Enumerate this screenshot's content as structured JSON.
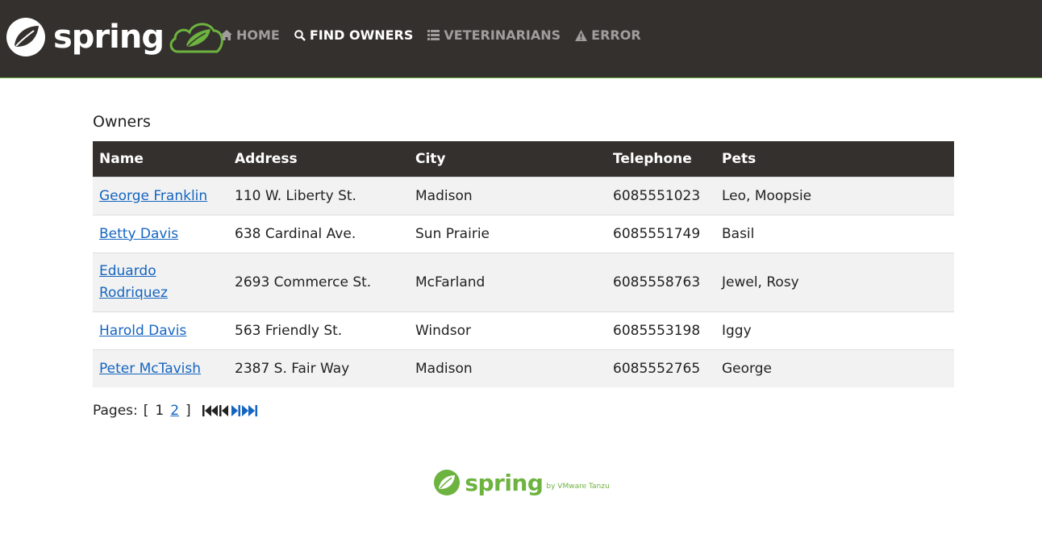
{
  "nav": {
    "brand": "spring",
    "items": [
      {
        "label": "HOME",
        "icon": "home-icon"
      },
      {
        "label": "FIND OWNERS",
        "icon": "search-icon",
        "active": true
      },
      {
        "label": "VETERINARIANS",
        "icon": "list-icon"
      },
      {
        "label": "ERROR",
        "icon": "warning-icon"
      }
    ]
  },
  "page": {
    "title": "Owners"
  },
  "table": {
    "headers": [
      "Name",
      "Address",
      "City",
      "Telephone",
      "Pets"
    ],
    "rows": [
      {
        "name": "George Franklin",
        "address": "110 W. Liberty St.",
        "city": "Madison",
        "telephone": "6085551023",
        "pets": "Leo, Moopsie"
      },
      {
        "name": "Betty Davis",
        "address": "638 Cardinal Ave.",
        "city": "Sun Prairie",
        "telephone": "6085551749",
        "pets": "Basil"
      },
      {
        "name": "Eduardo Rodriquez",
        "name_line1": "Eduardo",
        "name_line2": "Rodriquez",
        "address": "2693 Commerce St.",
        "city": "McFarland",
        "telephone": "6085558763",
        "pets": "Jewel, Rosy"
      },
      {
        "name": "Harold Davis",
        "address": "563 Friendly St.",
        "city": "Windsor",
        "telephone": "6085553198",
        "pets": "Iggy"
      },
      {
        "name": "Peter McTavish",
        "address": "2387 S. Fair Way",
        "city": "Madison",
        "telephone": "6085552765",
        "pets": "George"
      }
    ]
  },
  "pagination": {
    "label": "Pages:",
    "open_bracket": "[",
    "current": "1",
    "next_page": "2",
    "close_bracket": "]",
    "icons": [
      "first-page-icon",
      "previous-page-icon",
      "next-page-icon",
      "last-page-icon"
    ]
  },
  "footer": {
    "brand": "spring",
    "byline": "by VMware Tanzu"
  },
  "colors": {
    "navbar": "#34302d",
    "accent": "#6db33f",
    "link": "#1565c0",
    "nav_inactive": "#9f9e9d"
  }
}
